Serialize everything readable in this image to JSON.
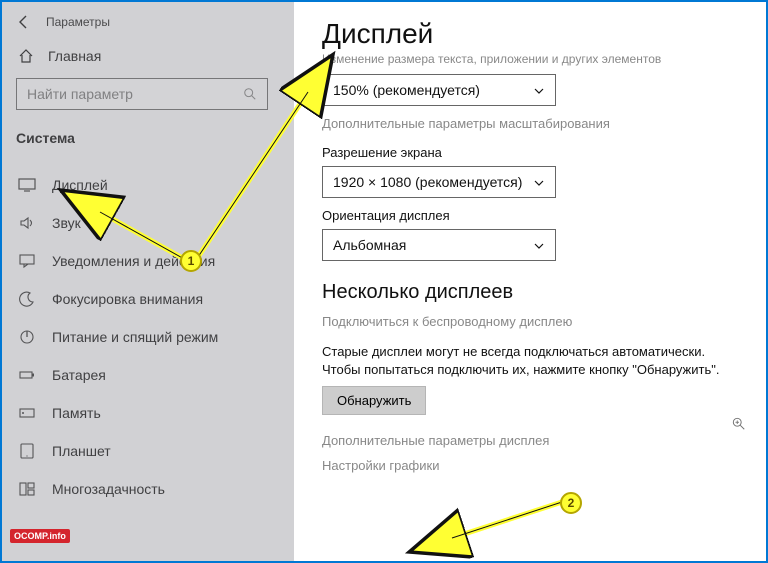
{
  "topbar": {
    "title": "Параметры"
  },
  "home": {
    "label": "Главная"
  },
  "search": {
    "placeholder": "Найти параметр"
  },
  "category": "Система",
  "nav": [
    {
      "label": "Дисплей"
    },
    {
      "label": "Звук"
    },
    {
      "label": "Уведомления и действия"
    },
    {
      "label": "Фокусировка внимания"
    },
    {
      "label": "Питание и спящий режим"
    },
    {
      "label": "Батарея"
    },
    {
      "label": "Память"
    },
    {
      "label": "Планшет"
    },
    {
      "label": "Многозадачность"
    }
  ],
  "main": {
    "heading": "Дисплей",
    "cutoff": "Изменение размера текста, приложении и других элементов",
    "scale_value": "150% (рекомендуется)",
    "scale_link": "Дополнительные параметры масштабирования",
    "res_label": "Разрешение экрана",
    "res_value": "1920 × 1080 (рекомендуется)",
    "orient_label": "Ориентация дисплея",
    "orient_value": "Альбомная",
    "multi_heading": "Несколько дисплеев",
    "wireless_link": "Подключиться к беспроводному дисплею",
    "detect_hint": "Старые дисплеи могут не всегда подключаться автоматически. Чтобы попытаться подключить их, нажмите кнопку \"Обнаружить\".",
    "detect_btn": "Обнаружить",
    "adv_display_link": "Дополнительные параметры дисплея",
    "graphics_link": "Настройки графики"
  },
  "annotations": {
    "badge1": "1",
    "badge2": "2"
  },
  "footer_logo": "OCOMP.info"
}
